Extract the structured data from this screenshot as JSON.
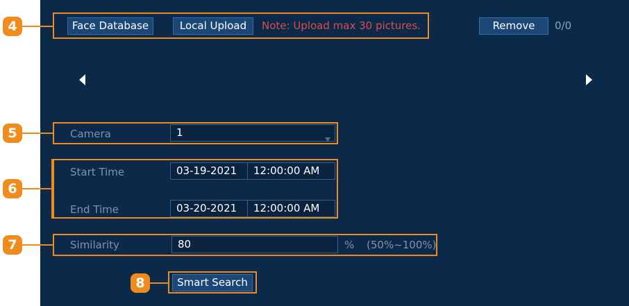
{
  "callouts": [
    "4",
    "5",
    "6",
    "7",
    "8"
  ],
  "toolbar": {
    "face_database_label": "Face Database",
    "local_upload_label": "Local Upload",
    "note": "Note: Upload max 30 pictures.",
    "remove_label": "Remove",
    "count": "0/0"
  },
  "nav": {
    "prev_icon": "triangle-left-icon",
    "next_icon": "triangle-right-icon"
  },
  "camera": {
    "label": "Camera",
    "value": "1"
  },
  "start_time": {
    "label": "Start Time",
    "date": "03-19-2021",
    "time": "12:00:00 AM"
  },
  "end_time": {
    "label": "End Time",
    "date": "03-20-2021",
    "time": "12:00:00 AM"
  },
  "similarity": {
    "label": "Similarity",
    "value": "80",
    "unit": "%",
    "range": "(50%~100%)"
  },
  "smart_search_label": "Smart Search",
  "colors": {
    "panel": "#0b2a4a",
    "button": "#1b4776",
    "note": "#e04a4a",
    "callout": "#f08b1e"
  }
}
